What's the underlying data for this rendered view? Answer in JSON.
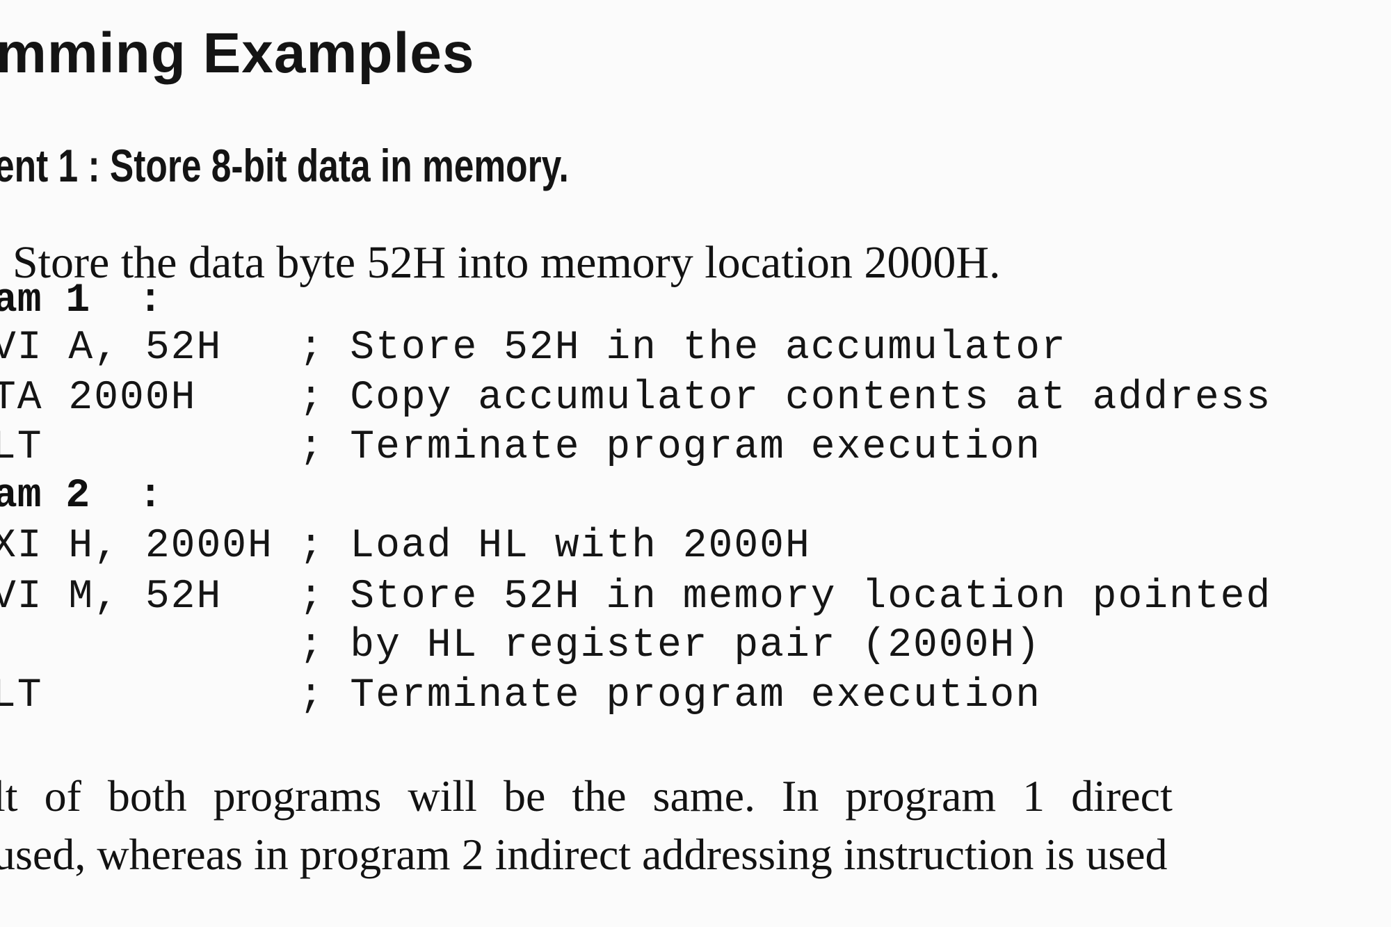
{
  "section_heading": "mming Examples",
  "experiment_title": "ent 1 : Store 8-bit data in memory.",
  "statement": "Store the data byte 52H into memory location 2000H.",
  "program1": {
    "label": "am 1  :",
    "lines": [
      "VI A, 52H   ; Store 52H in the accumulator",
      "TA 2000H    ; Copy accumulator contents at address",
      "LT          ; Terminate program execution"
    ]
  },
  "program2": {
    "label": "am 2  :",
    "lines": [
      "XI H, 2000H ; Load HL with 2000H",
      "VI M, 52H   ; Store 52H in memory location pointed",
      "            ; by HL register pair (2000H)",
      "LT          ; Terminate program execution"
    ]
  },
  "result": {
    "line1": "lt of both programs will be the same. In program 1 direct",
    "line2": "used, whereas in program 2 indirect addressing instruction is used"
  }
}
